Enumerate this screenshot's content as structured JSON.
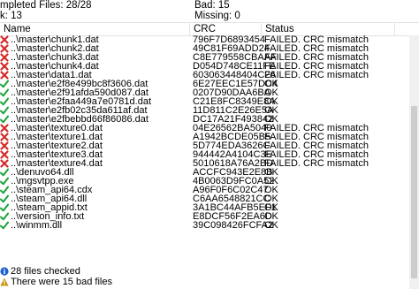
{
  "summary": {
    "completed": "mpleted Files: 28/28",
    "ok": "k: 13",
    "bad": "Bad: 15",
    "missing": "Missing: 0"
  },
  "columns": {
    "name": "Name",
    "crc": "CRC",
    "status": "Status"
  },
  "rows": [
    {
      "status_icon": "x-icon",
      "name": "..\\master\\chunk1.dat",
      "crc": "796F7D6893454",
      "status": "FAILED.  CRC mismatch"
    },
    {
      "status_icon": "x-icon",
      "name": "..\\master\\chunk2.dat",
      "crc": "49C81F69ADD24",
      "status": "FAILED.  CRC mismatch"
    },
    {
      "status_icon": "x-icon",
      "name": "..\\master\\chunk3.dat",
      "crc": "C8E779558CBAAF",
      "status": "FAILED.  CRC mismatch"
    },
    {
      "status_icon": "x-icon",
      "name": "..\\master\\chunk4.dat",
      "crc": "D054D748CE11FE",
      "status": "FAILED.  CRC mismatch"
    },
    {
      "status_icon": "x-icon",
      "name": "..\\master\\data1.dat",
      "crc": "603063448404C26",
      "status": "FAILED.  CRC mismatch"
    },
    {
      "status_icon": "check-icon",
      "name": "..\\master\\e2f8e499bc8f3606.dat",
      "crc": "6E27EEC1E57DC4",
      "status": "OK"
    },
    {
      "status_icon": "check-icon",
      "name": "..\\master\\e2f91afda590d087.dat",
      "crc": "0207D90DAA6BA",
      "status": "OK"
    },
    {
      "status_icon": "check-icon",
      "name": "..\\master\\e2faa449a7e0781d.dat",
      "crc": "C21E8FC8349E8A",
      "status": "OK"
    },
    {
      "status_icon": "check-icon",
      "name": "..\\master\\e2fb02c35da611af.dat",
      "crc": "11D811C2E26E5A",
      "status": "OK"
    },
    {
      "status_icon": "check-icon",
      "name": "..\\master\\e2fbebbd66f86086.dat",
      "crc": "DC17A21F493842",
      "status": "OK"
    },
    {
      "status_icon": "x-icon",
      "name": "..\\master\\texture0.dat",
      "crc": "04E26562BA5040",
      "status": "FAILED.  CRC mismatch"
    },
    {
      "status_icon": "x-icon",
      "name": "..\\master\\texture1.dat",
      "crc": "A1942BCDE05B5",
      "status": "FAILED.  CRC mismatch"
    },
    {
      "status_icon": "x-icon",
      "name": "..\\master\\texture2.dat",
      "crc": "5D774EDA3626C",
      "status": "FAILED.  CRC mismatch"
    },
    {
      "status_icon": "x-icon",
      "name": "..\\master\\texture3.dat",
      "crc": "944442A4104C3E",
      "status": "FAILED.  CRC mismatch"
    },
    {
      "status_icon": "x-icon",
      "name": "..\\master\\texture4.dat",
      "crc": "5010618A76A2BD",
      "status": "FAILED.  CRC mismatch"
    },
    {
      "status_icon": "check-icon",
      "name": "..\\denuvo64.dll",
      "crc": "ACCFC943E2E8B",
      "status": "OK"
    },
    {
      "status_icon": "check-icon",
      "name": "..\\mgsvtpp.exe",
      "crc": "4B0063D9FC0A52",
      "status": "OK"
    },
    {
      "status_icon": "check-icon",
      "name": "..\\steam_api64.cdx",
      "crc": "A96F0F6C02C47",
      "status": "OK"
    },
    {
      "status_icon": "check-icon",
      "name": "..\\steam_api64.dll",
      "crc": "C6AA6548821CC",
      "status": "OK"
    },
    {
      "status_icon": "check-icon",
      "name": "..\\steam_appid.txt",
      "crc": "3A1BC44AFB5EF1",
      "status": "OK"
    },
    {
      "status_icon": "check-icon",
      "name": "..\\version_info.txt",
      "crc": "E8DCF56F2EA6D",
      "status": "OK"
    },
    {
      "status_icon": "check-icon",
      "name": "..\\winmm.dll",
      "crc": "39C098426FCFA2",
      "status": "OK"
    }
  ],
  "messages": [
    {
      "icon": "info-icon",
      "text": "28 files checked"
    },
    {
      "icon": "warning-icon",
      "text": "There were 15 bad files"
    }
  ],
  "colors": {
    "fail": "#d62828",
    "ok": "#1aa53a",
    "info": "#1f5fd0",
    "warn": "#c9900b"
  }
}
